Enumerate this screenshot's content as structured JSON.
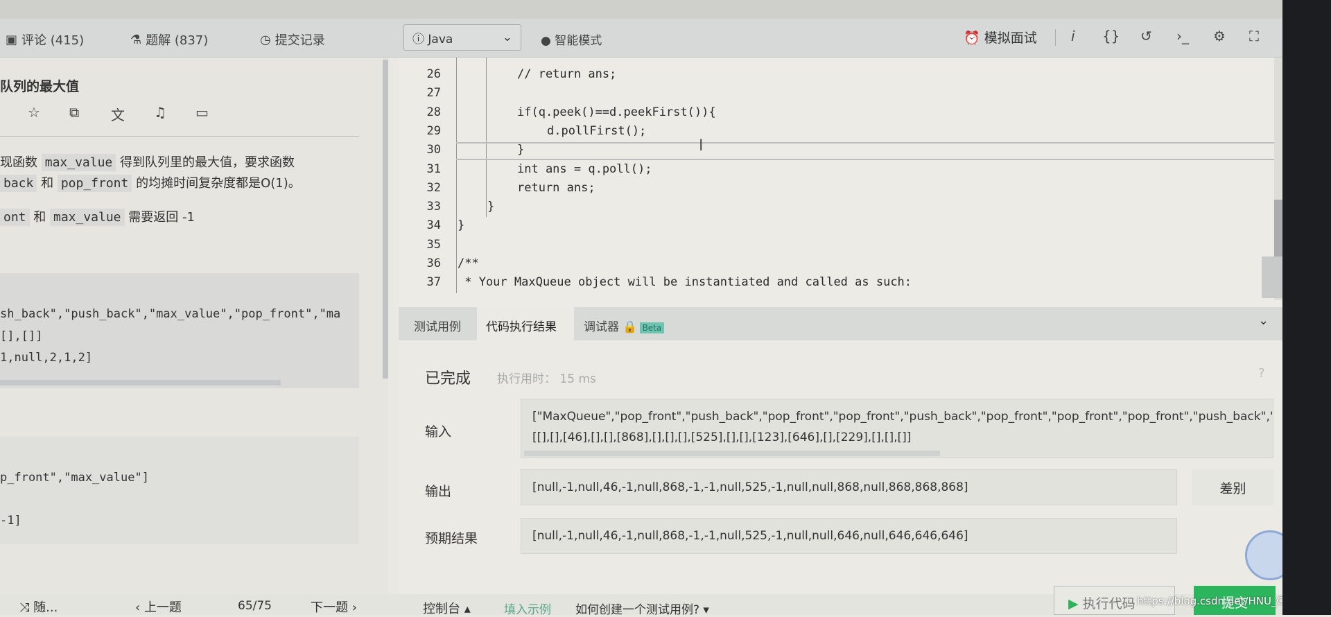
{
  "top_tabs": [
    {
      "label": "评论 (415)",
      "icon": "comment-icon"
    },
    {
      "label": "题解 (837)",
      "icon": "flask-icon"
    },
    {
      "label": "提交记录",
      "icon": "clock-icon"
    }
  ],
  "problem": {
    "title": "队列的最大值",
    "desc_line1_prefix": "现函数",
    "desc_code1": "max_value",
    "desc_line1_suffix": "得到队列里的最大值，要求函数",
    "desc_line2_code1": "back",
    "desc_line2_and": "和",
    "desc_line2_code2": "pop_front",
    "desc_line2_suffix": "的均摊时间复杂度都是O(1)。",
    "desc_line3_code1": "ont",
    "desc_line3_and": "和",
    "desc_line3_code2": "max_value",
    "desc_line3_suffix": "需要返回 -1",
    "example1": [
      "sh_back\",\"push_back\",\"max_value\",\"pop_front\",\"ma",
      "[],[]]",
      "1,null,2,1,2]"
    ],
    "example2": [
      "p_front\",\"max_value\"]",
      "-1]"
    ]
  },
  "editor_toolbar": {
    "language": "Java",
    "smart_mode": "智能模式",
    "mock_interview": "模拟面试"
  },
  "code_lines": [
    {
      "n": "26",
      "indent": 2,
      "text": "// return ans;"
    },
    {
      "n": "27",
      "indent": 0,
      "text": ""
    },
    {
      "n": "28",
      "indent": 2,
      "text": "if(q.peek()==d.peekFirst()){"
    },
    {
      "n": "29",
      "indent": 3,
      "text": "d.pollFirst();"
    },
    {
      "n": "30",
      "indent": 2,
      "text": "}"
    },
    {
      "n": "31",
      "indent": 2,
      "text": "int ans = q.poll();"
    },
    {
      "n": "32",
      "indent": 2,
      "text": "return ans;"
    },
    {
      "n": "33",
      "indent": 1,
      "text": "}"
    },
    {
      "n": "34",
      "indent": 0,
      "text": "}"
    },
    {
      "n": "35",
      "indent": 0,
      "text": ""
    },
    {
      "n": "36",
      "indent": 0,
      "text": "/**"
    },
    {
      "n": "37",
      "indent": 0,
      "text": " * Your MaxQueue object will be instantiated and called as such:"
    }
  ],
  "result_tabs": [
    {
      "label": "测试用例"
    },
    {
      "label": "代码执行结果",
      "active": true
    },
    {
      "label": "调试器",
      "badge": "Beta"
    }
  ],
  "result": {
    "status": "已完成",
    "runtime_label": "执行用时：",
    "runtime": "15 ms",
    "input_label": "输入",
    "input_line1": "[\"MaxQueue\",\"pop_front\",\"push_back\",\"pop_front\",\"pop_front\",\"push_back\",\"pop_front\",\"pop_front\",\"pop_front\",\"push_back\",\"pop_fr",
    "input_line2": "[[],[],[46],[],[],[868],[],[],[],[525],[],[],[123],[646],[],[229],[],[],[]]",
    "output_label": "输出",
    "output": "[null,-1,null,46,-1,null,868,-1,-1,null,525,-1,null,null,868,null,868,868,868]",
    "diff_button": "差别",
    "expected_label": "预期结果",
    "expected": "[null,-1,null,46,-1,null,868,-1,-1,null,525,-1,null,null,646,null,646,646,646]"
  },
  "bottom": {
    "random": "随...",
    "prev": "上一题",
    "page": "65/75",
    "next": "下一题",
    "console": "控制台",
    "fill_example": "填入示例",
    "how_to": "如何创建一个测试用例?",
    "run_code": "执行代码",
    "submit": "提交",
    "watermark": "https://blog.csdn.net/HNU_Csee_wjw"
  },
  "colors": {
    "accent_green": "#2db55d",
    "beta_badge": "#6cc5b0",
    "lock": "#e8913a"
  }
}
